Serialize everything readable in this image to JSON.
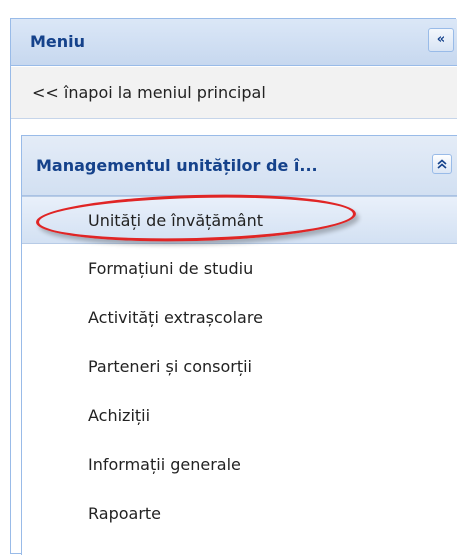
{
  "menu": {
    "title": "Meniu",
    "collapse_icon": "«"
  },
  "back_link": {
    "label": "<< înapoi la meniul principal"
  },
  "section": {
    "title": "Managementul unităților de î...",
    "toggle_icon": "double-chevron-up-icon",
    "toggle_glyph": "⌃"
  },
  "items": [
    {
      "label": "Unități de învățământ",
      "selected": true
    },
    {
      "label": "Formațiuni de studiu"
    },
    {
      "label": "Activități extrașcolare"
    },
    {
      "label": "Parteneri și consorții"
    },
    {
      "label": "Achiziții"
    },
    {
      "label": "Informații generale"
    },
    {
      "label": "Rapoarte"
    }
  ],
  "colors": {
    "header_text": "#15428b",
    "border": "#99bbe8",
    "highlight_ellipse": "#e02525"
  }
}
